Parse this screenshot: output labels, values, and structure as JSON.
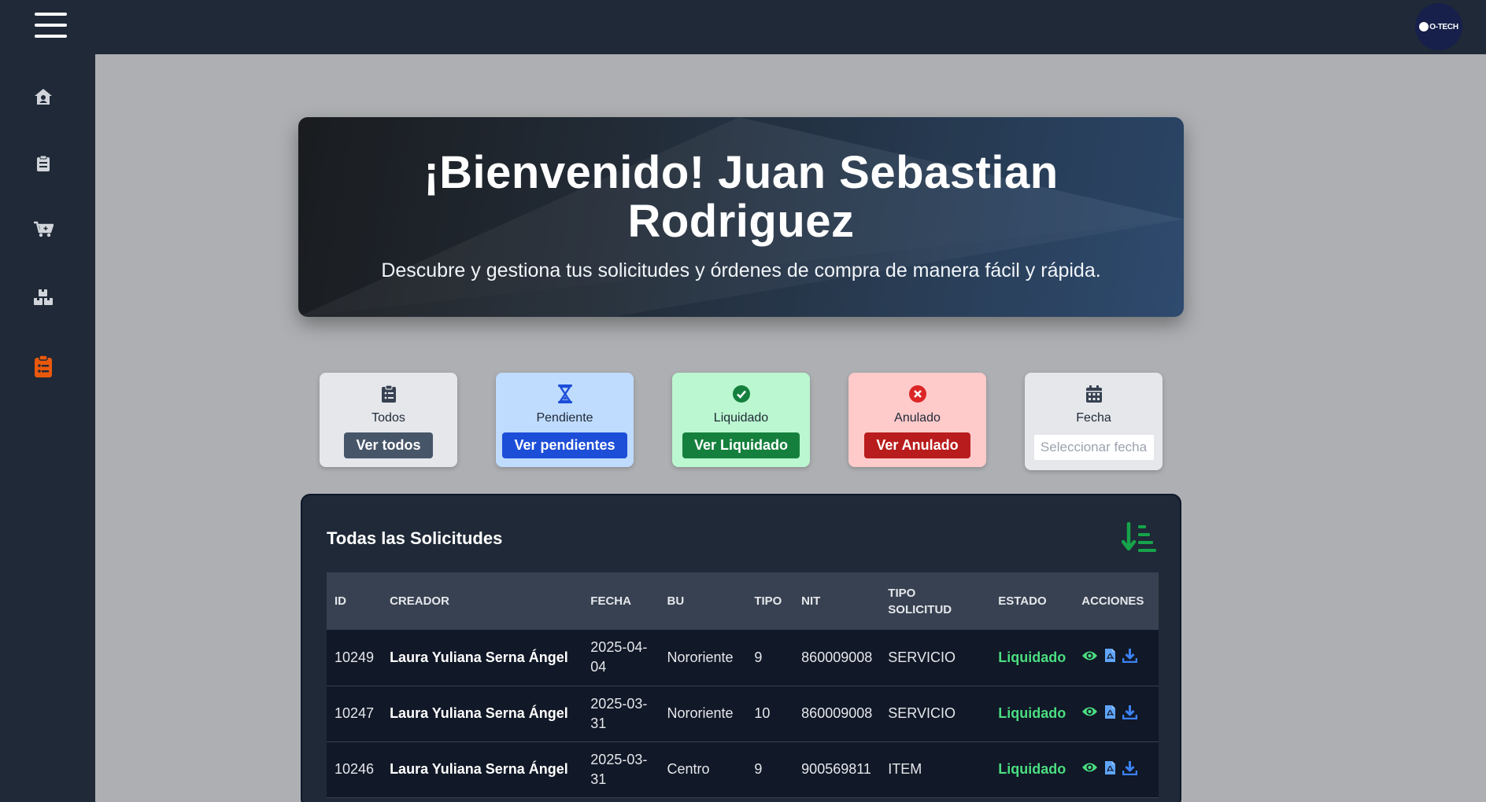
{
  "header": {
    "logo_text": "O-TECH"
  },
  "sidebar": {
    "items": [
      {
        "icon": "user-home-icon",
        "active": false
      },
      {
        "icon": "clipboard-icon",
        "active": false
      },
      {
        "icon": "cart-icon",
        "active": false
      },
      {
        "icon": "boxes-icon",
        "active": false
      },
      {
        "icon": "clipboard-list-icon",
        "active": true
      }
    ]
  },
  "hero": {
    "title": "¡Bienvenido! Juan Sebastian Rodriguez",
    "subtitle": "Descubre y gestiona tus solicitudes y órdenes de compra de manera fácil y rápida."
  },
  "filters": {
    "todos": {
      "label": "Todos",
      "button": "Ver todos"
    },
    "pendiente": {
      "label": "Pendiente",
      "button": "Ver pendientes"
    },
    "liquidado": {
      "label": "Liquidado",
      "button": "Ver Liquidado"
    },
    "anulado": {
      "label": "Anulado",
      "button": "Ver Anulado"
    },
    "fecha": {
      "label": "Fecha",
      "placeholder": "Seleccionar fecha"
    }
  },
  "table": {
    "title": "Todas las Solicitudes",
    "headers": {
      "id": "ID",
      "creador": "CREADOR",
      "fecha": "FECHA",
      "bu": "BU",
      "tipo": "TIPO",
      "nit": "NIT",
      "tipo_solicitud": "TIPO SOLICITUD",
      "estado": "ESTADO",
      "acciones": "ACCIONES"
    },
    "rows": [
      {
        "id": "10249",
        "creador": "Laura Yuliana Serna Ángel",
        "fecha": "2025-04-04",
        "bu": "Nororiente",
        "tipo": "9",
        "nit": "860009008",
        "tipo_solicitud": "SERVICIO",
        "estado": "Liquidado"
      },
      {
        "id": "10247",
        "creador": "Laura Yuliana Serna Ángel",
        "fecha": "2025-03-31",
        "bu": "Nororiente",
        "tipo": "10",
        "nit": "860009008",
        "tipo_solicitud": "SERVICIO",
        "estado": "Liquidado"
      },
      {
        "id": "10246",
        "creador": "Laura Yuliana Serna Ángel",
        "fecha": "2025-03-31",
        "bu": "Centro",
        "tipo": "9",
        "nit": "900569811",
        "tipo_solicitud": "ITEM",
        "estado": "Liquidado"
      }
    ],
    "row_actions": [
      "eye-icon",
      "file-pdf-icon",
      "download-icon"
    ]
  },
  "colors": {
    "topbar": "#1f2937",
    "accent_active": "#ea580c",
    "todos_btn": "#475569",
    "pendiente_btn": "#1d4ed8",
    "liquidado_btn": "#15803d",
    "anulado_btn": "#b91c1c",
    "estado_liquidado": "#4ade80"
  }
}
